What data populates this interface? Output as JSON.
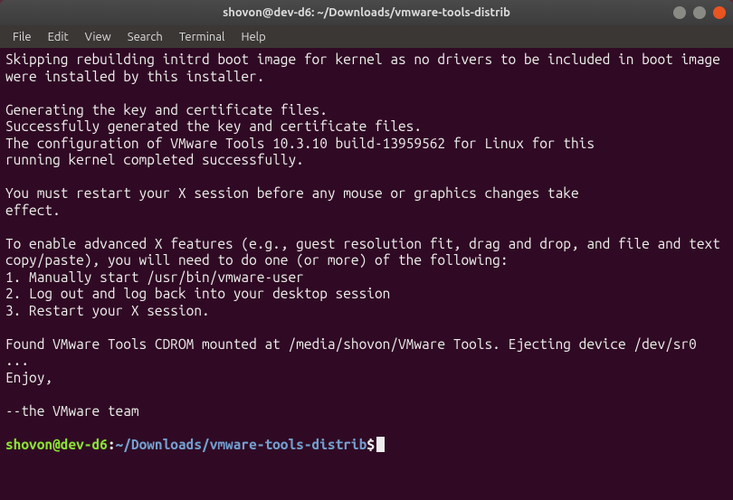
{
  "window": {
    "title": "shovon@dev-d6: ~/Downloads/vmware-tools-distrib"
  },
  "menubar": {
    "file": "File",
    "edit": "Edit",
    "view": "View",
    "search": "Search",
    "terminal": "Terminal",
    "help": "Help"
  },
  "terminal": {
    "lines": {
      "l0": "Skipping rebuilding initrd boot image for kernel as no drivers to be included in boot image were installed by this installer.",
      "l1": "",
      "l2": "Generating the key and certificate files.",
      "l3": "Successfully generated the key and certificate files.",
      "l4": "The configuration of VMware Tools 10.3.10 build-13959562 for Linux for this",
      "l5": "running kernel completed successfully.",
      "l6": "",
      "l7": "You must restart your X session before any mouse or graphics changes take",
      "l8": "effect.",
      "l9": "",
      "l10": "To enable advanced X features (e.g., guest resolution fit, drag and drop, and file and text copy/paste), you will need to do one (or more) of the following:",
      "l11": "1. Manually start /usr/bin/vmware-user",
      "l12": "2. Log out and log back into your desktop session",
      "l13": "3. Restart your X session.",
      "l14": "",
      "l15": "Found VMware Tools CDROM mounted at /media/shovon/VMware Tools. Ejecting device /dev/sr0 ...",
      "l16": "Enjoy,",
      "l17": "",
      "l18": "--the VMware team",
      "l19": ""
    },
    "prompt": {
      "user_host": "shovon@dev-d6",
      "colon": ":",
      "path": "~/Downloads/vmware-tools-distrib",
      "dollar": "$"
    }
  }
}
